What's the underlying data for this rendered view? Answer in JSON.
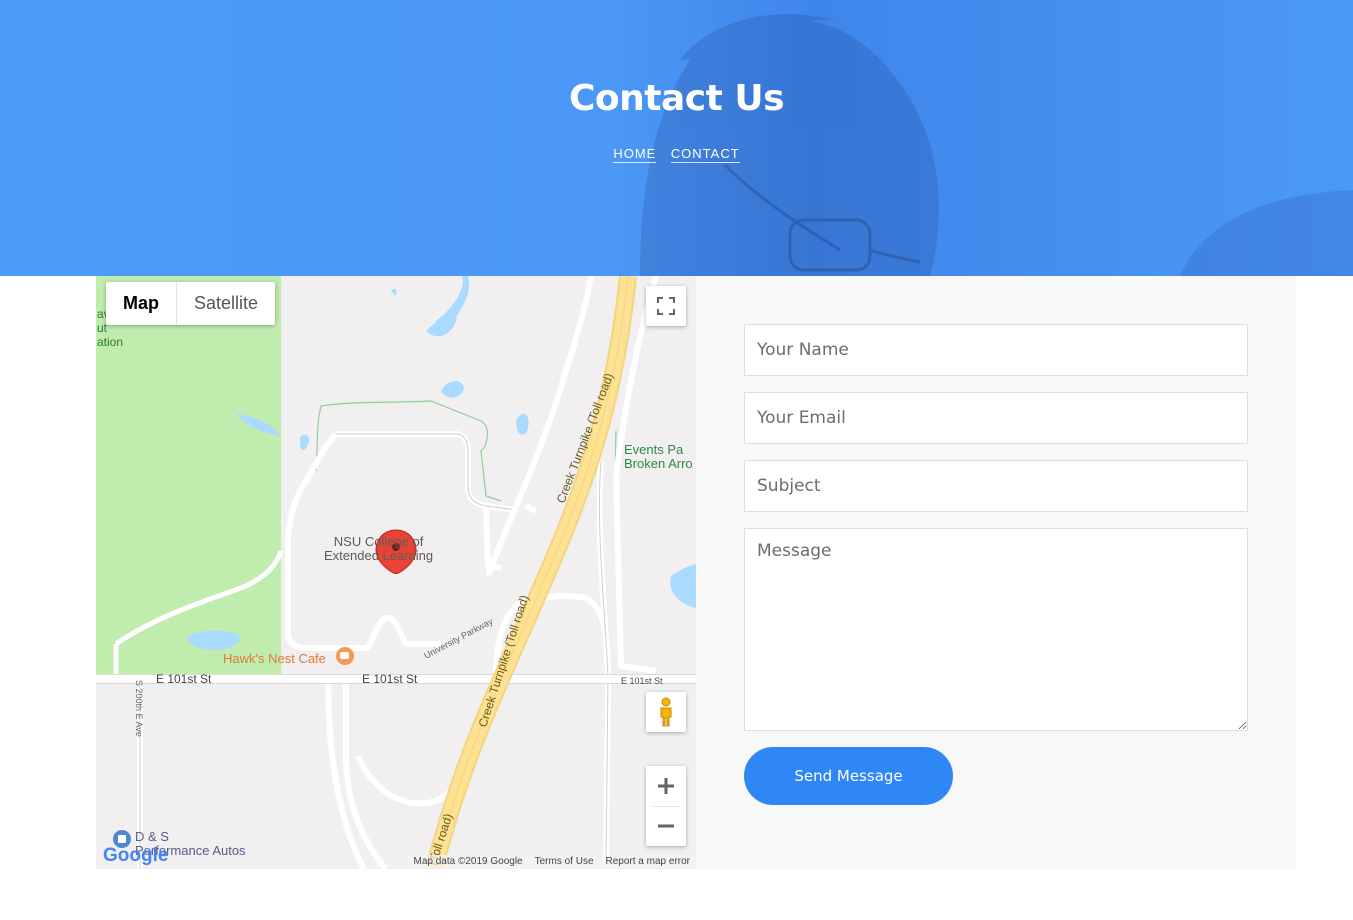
{
  "hero": {
    "title": "Contact Us",
    "breadcrumb": [
      "HOME",
      "CONTACT"
    ]
  },
  "map": {
    "type_toggle": {
      "map": "Map",
      "satellite": "Satellite"
    },
    "labels": {
      "college": [
        "NSU College of",
        "Extended Learning"
      ],
      "cafe": "Hawk's Nest Cafe",
      "events": [
        "Events Pa",
        "Broken Arro"
      ],
      "street_main": "E 101st St",
      "street_left": "E 101st St",
      "street_right": "E 101st St",
      "avenue": "S 200th E Ave",
      "parkway": "University Parkway",
      "turnpike_upper": "Creek Turnpike (Toll road)",
      "turnpike_lower": "Creek Turnpike (Toll road)",
      "turnpike_bottom": "(Toll road)",
      "left_edge": [
        "av",
        "ut",
        "ation"
      ],
      "autos": [
        "D & S",
        "Performance Autos"
      ]
    },
    "logo": "Google",
    "attribution": {
      "data": "Map data ©2019 Google",
      "terms": "Terms of Use",
      "report": "Report a map error"
    },
    "icons": {
      "fullscreen": "fullscreen-icon",
      "pegman": "pegman-icon",
      "zoom_in": "plus-icon",
      "zoom_out": "minus-icon",
      "marker": "map-pin-icon"
    }
  },
  "form": {
    "name_placeholder": "Your Name",
    "email_placeholder": "Your Email",
    "subject_placeholder": "Subject",
    "message_placeholder": "Message",
    "submit_label": "Send Message"
  },
  "colors": {
    "accent": "#2f86f5",
    "hero_overlay": "#4b98f6",
    "park_green": "#c0ecae",
    "water": "#aadaff",
    "toll_road": "#fde293"
  }
}
